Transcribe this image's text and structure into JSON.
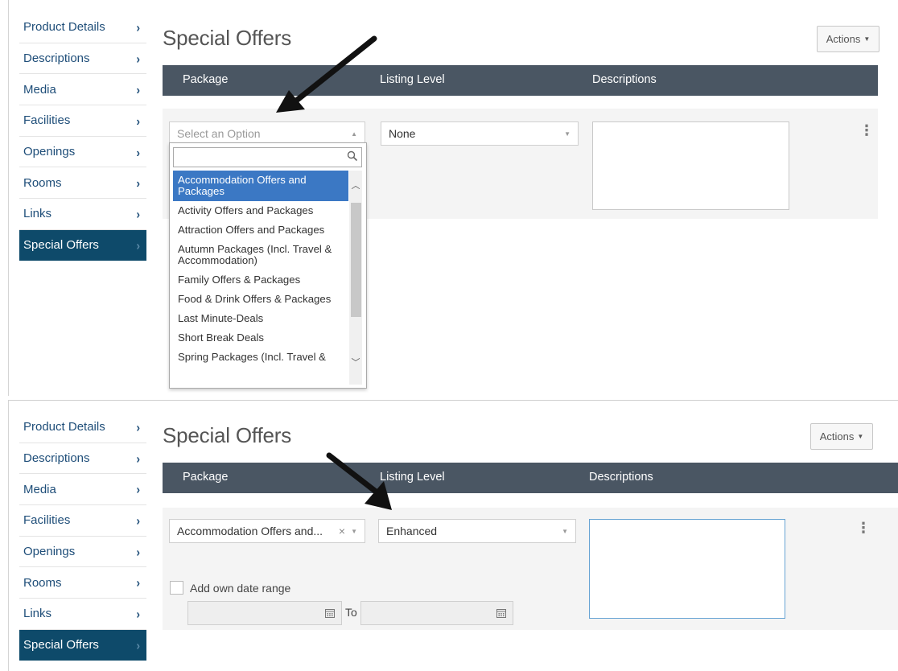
{
  "sidebar": {
    "items": [
      {
        "label": "Product Details"
      },
      {
        "label": "Descriptions"
      },
      {
        "label": "Media"
      },
      {
        "label": "Facilities"
      },
      {
        "label": "Openings"
      },
      {
        "label": "Rooms"
      },
      {
        "label": "Links"
      },
      {
        "label": "Special Offers"
      }
    ],
    "active": "Special Offers"
  },
  "page": {
    "title": "Special Offers",
    "actions_label": "Actions"
  },
  "table": {
    "columns": [
      "Package",
      "Listing Level",
      "Descriptions"
    ]
  },
  "top": {
    "package_placeholder": "Select an Option",
    "listing_level": "None",
    "dropdown_options": [
      "Accommodation Offers and Packages",
      "Activity Offers and Packages",
      "Attraction Offers and Packages",
      "Autumn Packages (Incl. Travel & Accommodation)",
      "Family Offers & Packages",
      "Food & Drink Offers & Packages",
      "Last Minute-Deals",
      "Short Break Deals",
      "Spring Packages (Incl. Travel &"
    ],
    "selected_option": "Accommodation Offers and Packages"
  },
  "bottom": {
    "package_value": "Accommodation Offers and...",
    "listing_level": "Enhanced",
    "date_range_label": "Add own date range",
    "to_label": "To"
  },
  "colors": {
    "nav_text": "#1f4e79",
    "nav_active_bg": "#0e4a6a",
    "header_bg": "#4a5663",
    "selected_option_bg": "#3b78c4"
  }
}
